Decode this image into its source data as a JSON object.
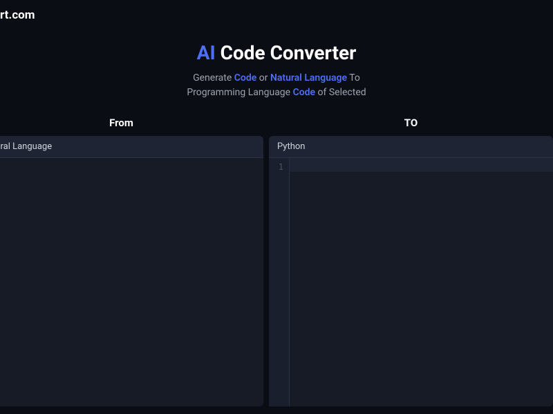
{
  "site": {
    "link_text": "rt.com"
  },
  "header": {
    "title_ai": "AI",
    "title_rest": "Code Converter",
    "subtitle_parts": {
      "p1": "Generate ",
      "p2": "Code",
      "p3": " or ",
      "p4": "Natural Language",
      "p5": " To",
      "p6": "Programming Language ",
      "p7": "Code",
      "p8": " of Selected"
    }
  },
  "from": {
    "label": "From",
    "selector": "atural Language"
  },
  "to": {
    "label": "TO",
    "selector": "Python",
    "line_number": "1"
  }
}
